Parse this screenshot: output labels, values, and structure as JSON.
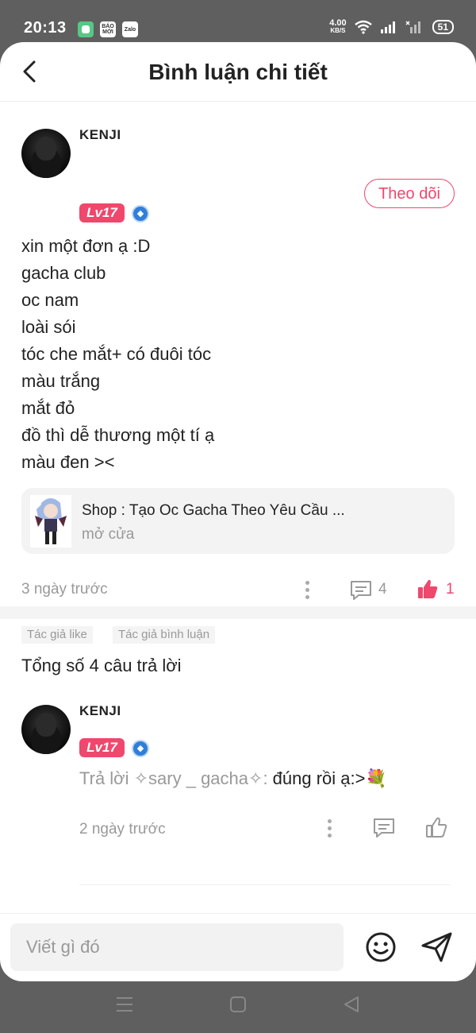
{
  "status_bar": {
    "time": "20:13",
    "app_icons": [
      "messages-icon",
      "bao-moi-icon",
      "zalo-icon"
    ],
    "bao_moi_label": "BÁO MỚI",
    "zalo_label": "Zalo",
    "net_speed": "4.00",
    "net_unit": "KB/S",
    "battery": "51"
  },
  "header": {
    "title": "Bình luận chi tiết"
  },
  "post": {
    "username": "KENJI",
    "level": "Lv17",
    "follow_label": "Theo dõi",
    "body_lines": [
      "xin một đơn ạ :D",
      "gacha club",
      "oc nam",
      "loài sói",
      "tóc che mắt+ có đuôi tóc",
      "màu trắng",
      "mắt đỏ",
      "đồ thì dễ thương một tí ạ",
      "màu đen ><"
    ],
    "shop": {
      "title": "Shop : Tạo Oc Gacha Theo Yêu Cầu ...",
      "status": "mở cửa"
    },
    "time_ago": "3 ngày trước",
    "comment_count": "4",
    "like_count": "1",
    "tags": [
      "Tác giả like",
      "Tác giả bình luận"
    ]
  },
  "replies": {
    "total_label": "Tổng số 4 câu trả lời",
    "items": [
      {
        "username": "KENJI",
        "level": "Lv17",
        "reply_prefix": "Trả lời ✧sary _ gacha✧:",
        "reply_text": " đúng rồi ạ:>💐",
        "time_ago": "2 ngày trước"
      }
    ]
  },
  "composer": {
    "placeholder": "Viết gì đó"
  },
  "colors": {
    "accent": "#f0476d",
    "muted": "#999999",
    "verify": "#2f7fd9"
  }
}
